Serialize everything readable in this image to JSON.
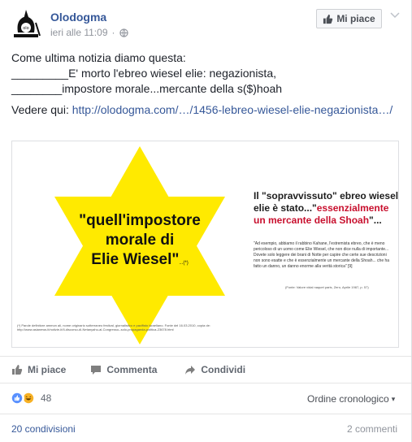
{
  "post": {
    "page_name": "Olodogma",
    "timestamp": "ieri alle 11:09",
    "privacy_separator": "·",
    "like_page_label": "Mi piace",
    "text_lines": [
      "Come ultima notizia diamo questa:",
      "_________E' morto l'ebreo wiesel elie: negazionista,",
      "________impostore morale...mercante della s($)hoah"
    ],
    "link_prefix": "Vedere qui: ",
    "link_text": "http://olodogma.com/…/1456-lebreo-wiesel-elie-negazionista…/"
  },
  "image": {
    "star_line1": "\"quell'impostore",
    "star_line2": "morale di",
    "star_line3": "Elie Wiesel\"",
    "star_note": "...(*)",
    "right_title_1": "Il \"sopravvissuto\" ebreo wiesel",
    "right_title_2": "elie è stato...\"",
    "right_title_red": "essenzialmente un mercante della Shoah",
    "right_title_end": "\"...",
    "right_body": "\"Ad esempio, abbiamo il rabbino Kahane, l'estremista ebreo, che è meno pericoloso di un uomo come Elie Wiesel, che non dice nulla di importante... Dovete solo leggere dei brani di Notte per capire che certe sue descrizioni non sono esatte e che è essenzialmente un mercante della Shoah... che ha fatto un danno, un danno enorme alla verità storica\" [9]",
    "right_source": "(Fonte: Valore vidal naquet paris, Zero, Aprile 1987, p. 57)",
    "footnote": "(*) Parole definitore ammon ali, nome originario sotterraneo festival, giornalistico e pacifisto israeliano. Fonte del 16.03.2010, copia de: http://www.asianews.it/notizie-it/Il-discorso-di-Netanyahu-al-Congresso--solo-propaganda-politica-23678.html"
  },
  "actions": {
    "like": "Mi piace",
    "comment": "Commenta",
    "share": "Condividi"
  },
  "reactions": {
    "count": "48",
    "order_label": "Ordine cronologico",
    "order_caret": "▾"
  },
  "footer": {
    "shares": "20 condivisioni",
    "comments": "2 commenti"
  },
  "colors": {
    "link": "#365899",
    "star": "#ffea00",
    "like_blue": "#5890ff",
    "haha_yellow": "#f7b125",
    "red_text": "#c8102e"
  }
}
